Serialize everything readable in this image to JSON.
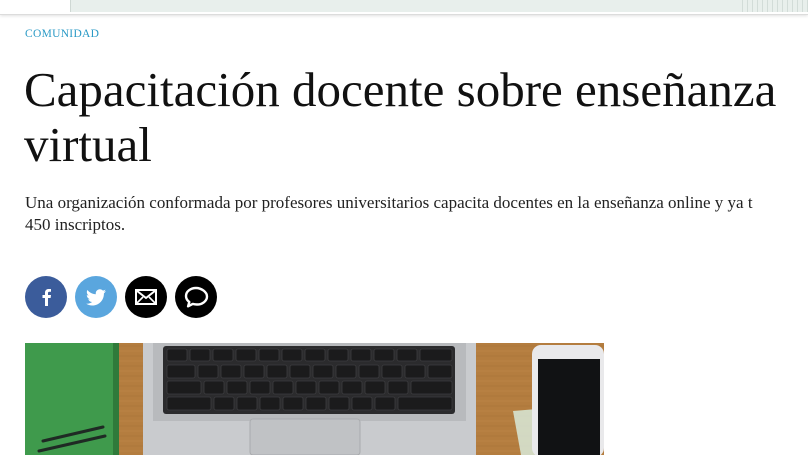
{
  "section": {
    "label": "COMUNIDAD"
  },
  "article": {
    "title_lines": [
      "Capacitación docente sobre enseñanza",
      "virtual"
    ],
    "subtitle_lines": [
      "Una organización conformada por profesores universitarios capacita docentes en la enseñanza online y ya t",
      "450 inscriptos."
    ]
  },
  "share": {
    "buttons": [
      {
        "name": "facebook",
        "icon": "facebook-icon",
        "color": "#3b5c9b"
      },
      {
        "name": "twitter",
        "icon": "twitter-icon",
        "color": "#5aa6de"
      },
      {
        "name": "email",
        "icon": "envelope-icon",
        "color": "#000000"
      },
      {
        "name": "comments",
        "icon": "speech-bubble-icon",
        "color": "#000000"
      }
    ]
  },
  "colors": {
    "section_label": "#2a9ac6",
    "headline": "#111111",
    "desk_wood": "#b47d3f",
    "notebook_green": "#3f9a4c"
  }
}
